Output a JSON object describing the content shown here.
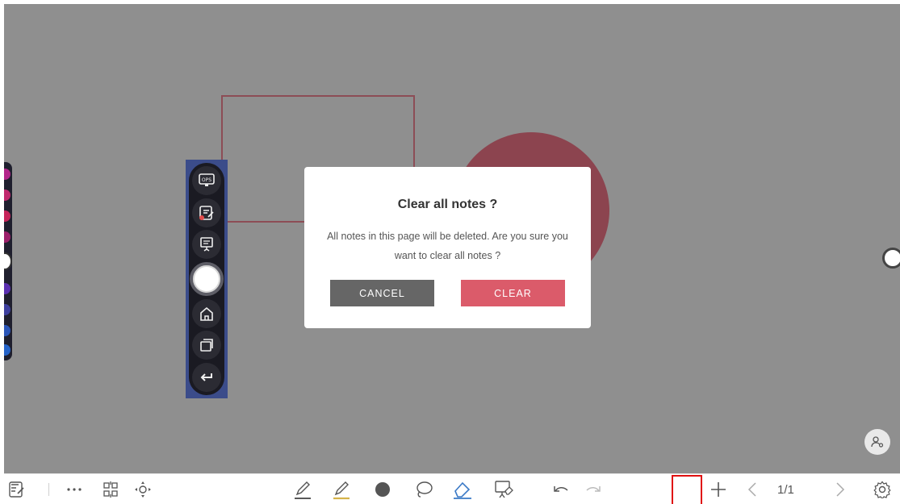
{
  "dialog": {
    "title": "Clear all notes ?",
    "message": "All notes in this page will be deleted. Are you sure you want to clear all notes ?",
    "cancel_label": "CANCEL",
    "clear_label": "CLEAR"
  },
  "floating_toolbar": {
    "items": [
      {
        "icon": "ops-monitor-icon",
        "label": "OPS"
      },
      {
        "icon": "annotate-icon"
      },
      {
        "icon": "whiteboard-icon"
      },
      {
        "icon": "main-menu-button"
      },
      {
        "icon": "home-icon"
      },
      {
        "icon": "windows-icon"
      },
      {
        "icon": "back-icon"
      }
    ]
  },
  "bottom_toolbar": {
    "page_indicator": "1/1",
    "tools": [
      "exit-icon",
      "more-icon",
      "qr-code-icon",
      "move-icon",
      "pen-icon",
      "highlighter-icon",
      "color-dot-icon",
      "lasso-icon",
      "eraser-icon",
      "clear-board-icon",
      "undo-icon",
      "redo-icon",
      "add-page-icon",
      "prev-page-icon",
      "next-page-icon",
      "settings-icon"
    ]
  },
  "colors": {
    "canvas_bg": "#8f8f8f",
    "shape_stroke": "#8d4d56",
    "shape_fill": "#8c444f",
    "clear_button": "#db5b6a",
    "cancel_button": "#666666",
    "highlight_box": "#e01010",
    "eraser_active": "#3a79c6"
  }
}
